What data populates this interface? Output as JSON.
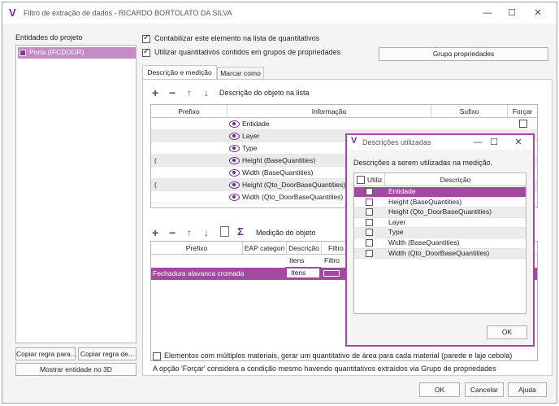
{
  "window": {
    "title": "Filtro de extração de dados - RICARDO BORTOLATO DA SILVA",
    "minimize": "—",
    "maximize": "☐",
    "close": "✕"
  },
  "left": {
    "heading": "Entidades do projeto",
    "tree_item": "Porta (IFCDOOR)",
    "copy_rule_1": "Copiar regra para...",
    "copy_rule_2": "Copiar regra de...",
    "show_3d": "Mostrar entidade no 3D"
  },
  "top_options": {
    "count_label": "Contabilizar este elemento na lista de quantitativos",
    "use_groups_label": "Utilizar quantitativos contidos em grupos de propriedades",
    "group_props_button": "Grupo propriedades"
  },
  "tabs": [
    "Descrição e medição",
    "Marcar como"
  ],
  "desc_section": {
    "toolbar_label": "Descrição do objeto na lista",
    "columns": [
      "Prefixo",
      "Informação",
      "Sufixo",
      "Forçar"
    ],
    "rows": [
      {
        "prefix": "",
        "info": "Entidade"
      },
      {
        "prefix": "",
        "info": "Layer"
      },
      {
        "prefix": "",
        "info": "Type"
      },
      {
        "prefix": "(",
        "info": "Height (BaseQuantities)"
      },
      {
        "prefix": "",
        "info": "Width (BaseQuantities)"
      },
      {
        "prefix": "(",
        "info": "Height (Qto_DoorBaseQuantities)"
      },
      {
        "prefix": "",
        "info": "Width (Qto_DoorBaseQuantities)"
      }
    ]
  },
  "measure_section": {
    "toolbar_label": "Medição do objeto",
    "columns": [
      "Prefixo",
      "EAP categori",
      "Descrição",
      "Filtro"
    ],
    "sub_descr": "Itens",
    "sub_filter": "Filtro",
    "row_prefix": "Fechadura alavanca cromada",
    "row_descr": "Itens"
  },
  "bottom": {
    "multi_material": "Elementos com múltiplos materiais, gerar um quantitativo de área para cada material (parede e laje cebola)",
    "force_note": "A opção 'Forçar' considera a condição mesmo havendo quantitativos extraídos via Grupo de propriedades",
    "ok": "OK",
    "cancel": "Cancelar",
    "help": "Ajuda"
  },
  "dialog": {
    "title": "Descrições utilizadas",
    "subtitle": "Descrições a serem utilizadas na medição.",
    "col_use": "Utiliz",
    "col_desc": "Descrição",
    "items": [
      "Entidade",
      "Height (BaseQuantities)",
      "Height (Qto_DoorBaseQuantities)",
      "Layer",
      "Type",
      "Width (BaseQuantities)",
      "Width (Qto_DoorBaseQuantities)"
    ],
    "ok": "OK"
  },
  "colors": {
    "accent": "#6a2c91",
    "highlight": "#a24aa2"
  }
}
